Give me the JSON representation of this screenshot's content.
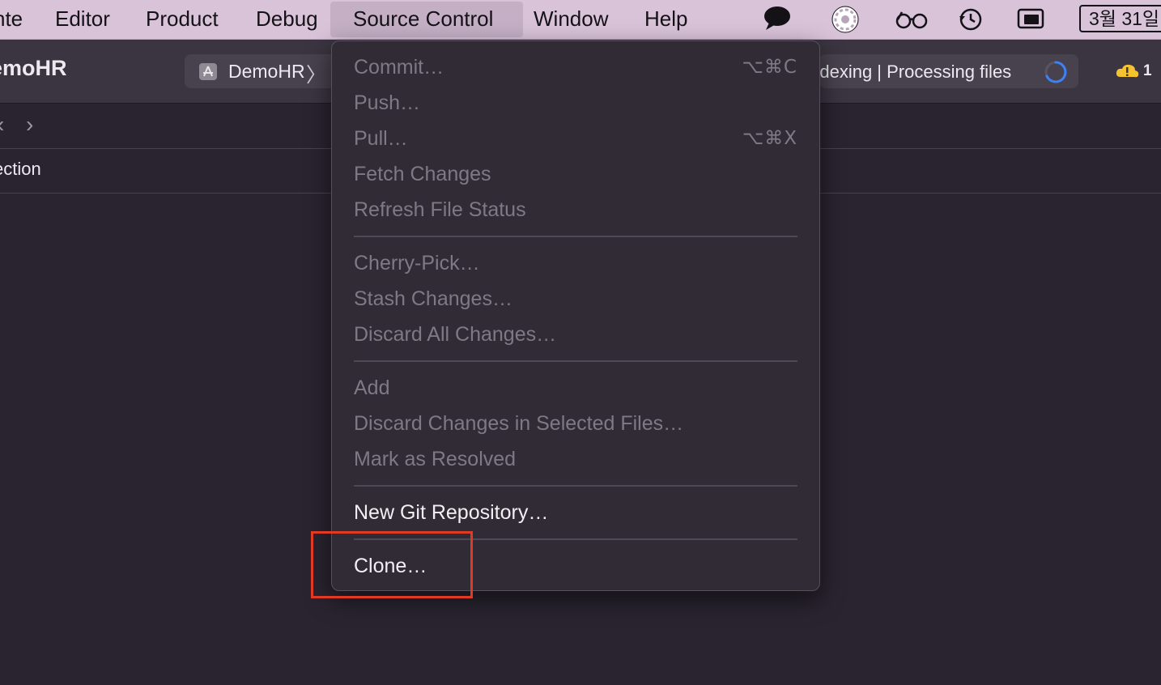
{
  "menubar": {
    "items": [
      "nte",
      "Editor",
      "Product",
      "Debug",
      "Source Control",
      "Window",
      "Help"
    ],
    "open_menu": "Source Control",
    "status_icons": [
      "messages-icon",
      "settings-wheel-icon",
      "glasses-icon",
      "time-machine-icon",
      "screen-mirroring-icon"
    ],
    "date": "3월 31일"
  },
  "toolbar": {
    "project_name": "emoHR",
    "scheme_label": "DemoHR",
    "scheme_chevron": "〉",
    "activity_text": "Indexing | Processing files",
    "warning_count": "1"
  },
  "editor": {
    "back_arrow": "‹",
    "forward_arrow": "›",
    "section_label": "ection"
  },
  "dropdown": {
    "groups": [
      [
        {
          "label": "Commit…",
          "shortcut": "⌥⌘C",
          "enabled": false
        },
        {
          "label": "Push…",
          "shortcut": "",
          "enabled": false
        },
        {
          "label": "Pull…",
          "shortcut": "⌥⌘X",
          "enabled": false
        },
        {
          "label": "Fetch Changes",
          "shortcut": "",
          "enabled": false
        },
        {
          "label": "Refresh File Status",
          "shortcut": "",
          "enabled": false
        }
      ],
      [
        {
          "label": "Cherry-Pick…",
          "shortcut": "",
          "enabled": false
        },
        {
          "label": "Stash Changes…",
          "shortcut": "",
          "enabled": false
        },
        {
          "label": "Discard All Changes…",
          "shortcut": "",
          "enabled": false
        }
      ],
      [
        {
          "label": "Add",
          "shortcut": "",
          "enabled": false
        },
        {
          "label": "Discard Changes in Selected Files…",
          "shortcut": "",
          "enabled": false
        },
        {
          "label": "Mark as Resolved",
          "shortcut": "",
          "enabled": false
        }
      ],
      [
        {
          "label": "New Git Repository…",
          "shortcut": "",
          "enabled": true
        }
      ],
      [
        {
          "label": "Clone…",
          "shortcut": "",
          "enabled": true
        }
      ]
    ]
  },
  "colors": {
    "menubar_bg": "#d9c3d9",
    "window_bg": "#29242f",
    "dropdown_bg": "#302b35",
    "highlight_border": "#e03a25",
    "warning": "#f5c230",
    "spinner": "#3b82f6"
  }
}
